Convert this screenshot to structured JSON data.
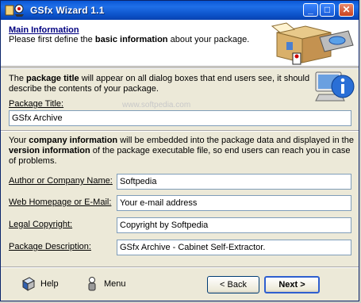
{
  "window": {
    "title": "GSfx Wizard 1.1"
  },
  "header": {
    "title": "Main Information",
    "desc_pre": "Please first define the ",
    "desc_bold": "basic information",
    "desc_post": " about your package."
  },
  "section1": {
    "pre": "The ",
    "bold": "package title",
    "post": " will appear on all dialog boxes that end users see, it should describe the contents of your package."
  },
  "section2": {
    "pre": "Your ",
    "bold1": "company information",
    "mid": " will be embedded into the package data and displayed in the ",
    "bold2": "version information",
    "post": " of the package executable file, so end users can reach you in case of problems."
  },
  "watermark": "www.softpedia.com",
  "fields": {
    "package_title": {
      "label": "Package Title:",
      "value": "GSfx Archive"
    },
    "author": {
      "label": "Author or Company Name:",
      "value": "Softpedia"
    },
    "web": {
      "label": "Web Homepage or E-Mail:",
      "value": "Your e-mail address"
    },
    "copyright": {
      "label": "Legal Copyright:",
      "value": "Copyright by Softpedia"
    },
    "description": {
      "label": "Package Description:",
      "value": "GSfx Archive - Cabinet Self-Extractor."
    }
  },
  "footer": {
    "help": "Help",
    "menu": "Menu",
    "back": "< Back",
    "next": "Next >"
  },
  "icons": {
    "app": "wizard-app-icon",
    "header": "package-box-icon",
    "info": "info-computer-icon",
    "help": "help-book-icon",
    "menu": "menu-figure-icon"
  }
}
